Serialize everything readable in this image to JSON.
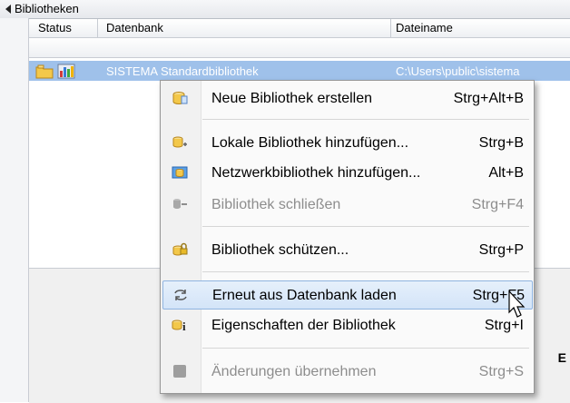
{
  "panel": {
    "title": "Bibliotheken"
  },
  "columns": {
    "status": "Status",
    "datenbank": "Datenbank",
    "dateiname": "Dateiname"
  },
  "row": {
    "datenbank": "SISTEMA Standardbibliothek",
    "dateiname": "C:\\Users\\public\\sistema"
  },
  "menu": {
    "items": [
      {
        "label": "Neue Bibliothek erstellen",
        "shortcut": "Strg+Alt+B",
        "icon": "new-library-icon",
        "enabled": true
      },
      {
        "label": "Lokale Bibliothek hinzufügen...",
        "shortcut": "Strg+B",
        "icon": "add-local-library-icon",
        "enabled": true
      },
      {
        "label": "Netzwerkbibliothek hinzufügen...",
        "shortcut": "Alt+B",
        "icon": "network-library-icon",
        "enabled": true
      },
      {
        "label": "Bibliothek schließen",
        "shortcut": "Strg+F4",
        "icon": "close-library-icon",
        "enabled": false
      },
      {
        "label": "Bibliothek schützen...",
        "shortcut": "Strg+P",
        "icon": "lock-library-icon",
        "enabled": true
      },
      {
        "label": "Erneut aus Datenbank laden",
        "shortcut": "Strg+F5",
        "icon": "reload-icon",
        "enabled": true,
        "hovered": true
      },
      {
        "label": "Eigenschaften der Bibliothek",
        "shortcut": "Strg+I",
        "icon": "properties-icon",
        "enabled": true
      },
      {
        "label": "Änderungen übernehmen",
        "shortcut": "Strg+S",
        "icon": "apply-changes-icon",
        "enabled": false
      }
    ]
  },
  "lower": {
    "partial_text": "E"
  },
  "colors": {
    "selection": "#9fc1ea",
    "hover": "#d3e4f8",
    "disabled_text": "#8d8d8d"
  }
}
